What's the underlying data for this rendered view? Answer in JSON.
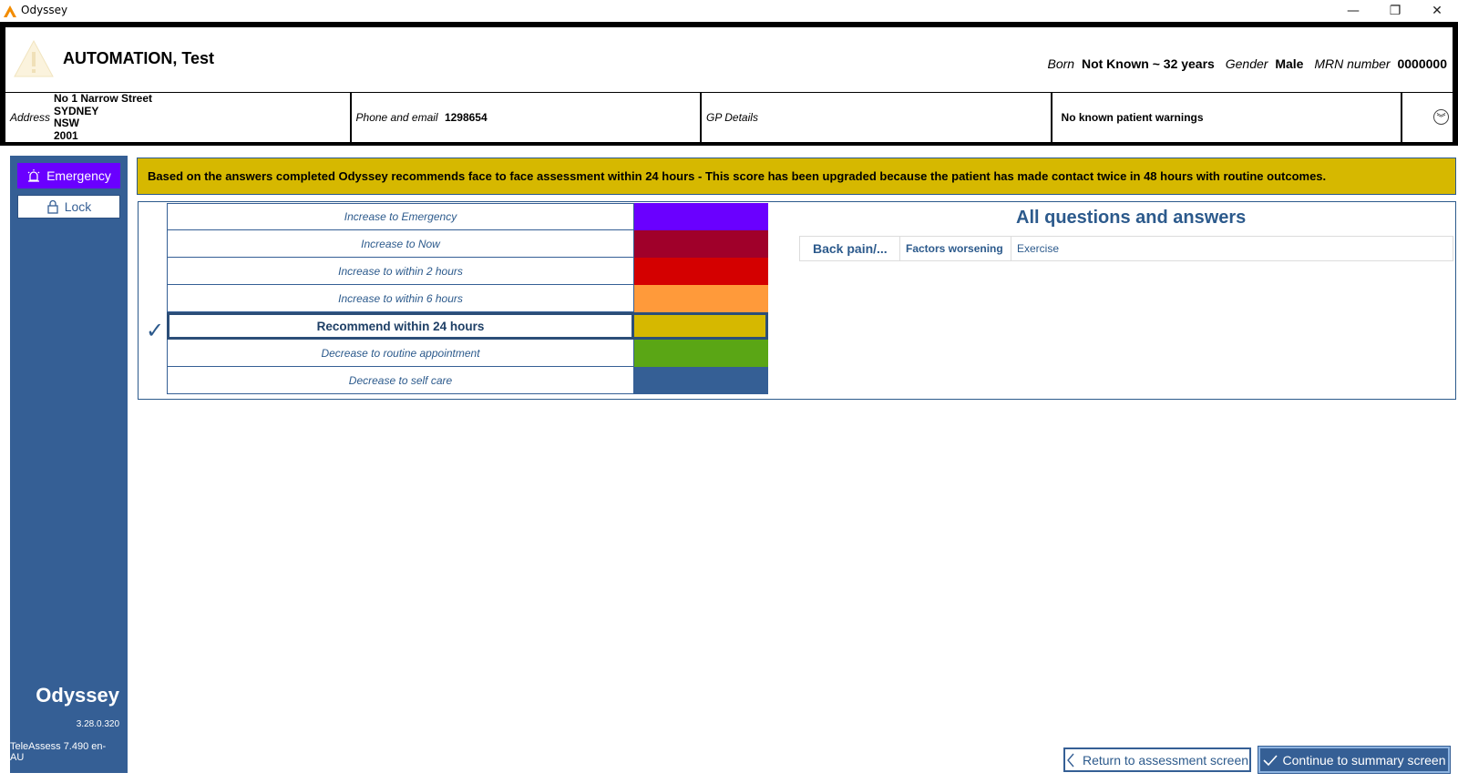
{
  "window": {
    "title": "Odyssey",
    "minimize_glyph": "—",
    "restore_glyph": "❐",
    "close_glyph": "✕"
  },
  "patient": {
    "name": "AUTOMATION, Test",
    "born_label": "Born",
    "born_value": "Not Known ~ 32 years",
    "gender_label": "Gender",
    "gender_value": "Male",
    "mrn_label": "MRN number",
    "mrn_value": "0000000",
    "address_label": "Address",
    "address_lines": [
      "No 1 Narrow Street",
      "SYDNEY",
      "NSW",
      "2001"
    ],
    "phone_label": "Phone and email",
    "phone_value": "1298654",
    "gp_label": "GP Details",
    "warnings": "No known patient warnings"
  },
  "sidebar": {
    "emergency_label": "Emergency",
    "lock_label": "Lock",
    "brand": "Odyssey",
    "version": "3.28.0.320",
    "locale": "TeleAssess 7.490 en-AU",
    "emergency_color": "#6a00ff"
  },
  "recommendation": {
    "text": "Based on the answers completed Odyssey recommends face to face assessment within 24 hours - This score has been upgraded because the patient has made contact twice in 48 hours with routine outcomes.",
    "color": "#d6b800"
  },
  "triage_options": [
    {
      "label": "Increase to Emergency",
      "color": "#6a00ff",
      "selected": false
    },
    {
      "label": "Increase to Now",
      "color": "#a0002a",
      "selected": false
    },
    {
      "label": "Increase to within 2 hours",
      "color": "#d40000",
      "selected": false
    },
    {
      "label": "Increase to within 6 hours",
      "color": "#ff9a3a",
      "selected": false
    },
    {
      "label": "Recommend within 24 hours",
      "color": "#d6b800",
      "selected": true
    },
    {
      "label": "Decrease to routine appointment",
      "color": "#5aa615",
      "selected": false
    },
    {
      "label": "Decrease to self care",
      "color": "#355f95",
      "selected": false
    }
  ],
  "qa": {
    "title": "All questions and answers",
    "rows": [
      {
        "category": "Back pain/...",
        "question": "Factors worsening",
        "answer": "Exercise"
      }
    ]
  },
  "footer": {
    "return_label": "Return to assessment screen",
    "continue_label": "Continue to summary screen"
  }
}
